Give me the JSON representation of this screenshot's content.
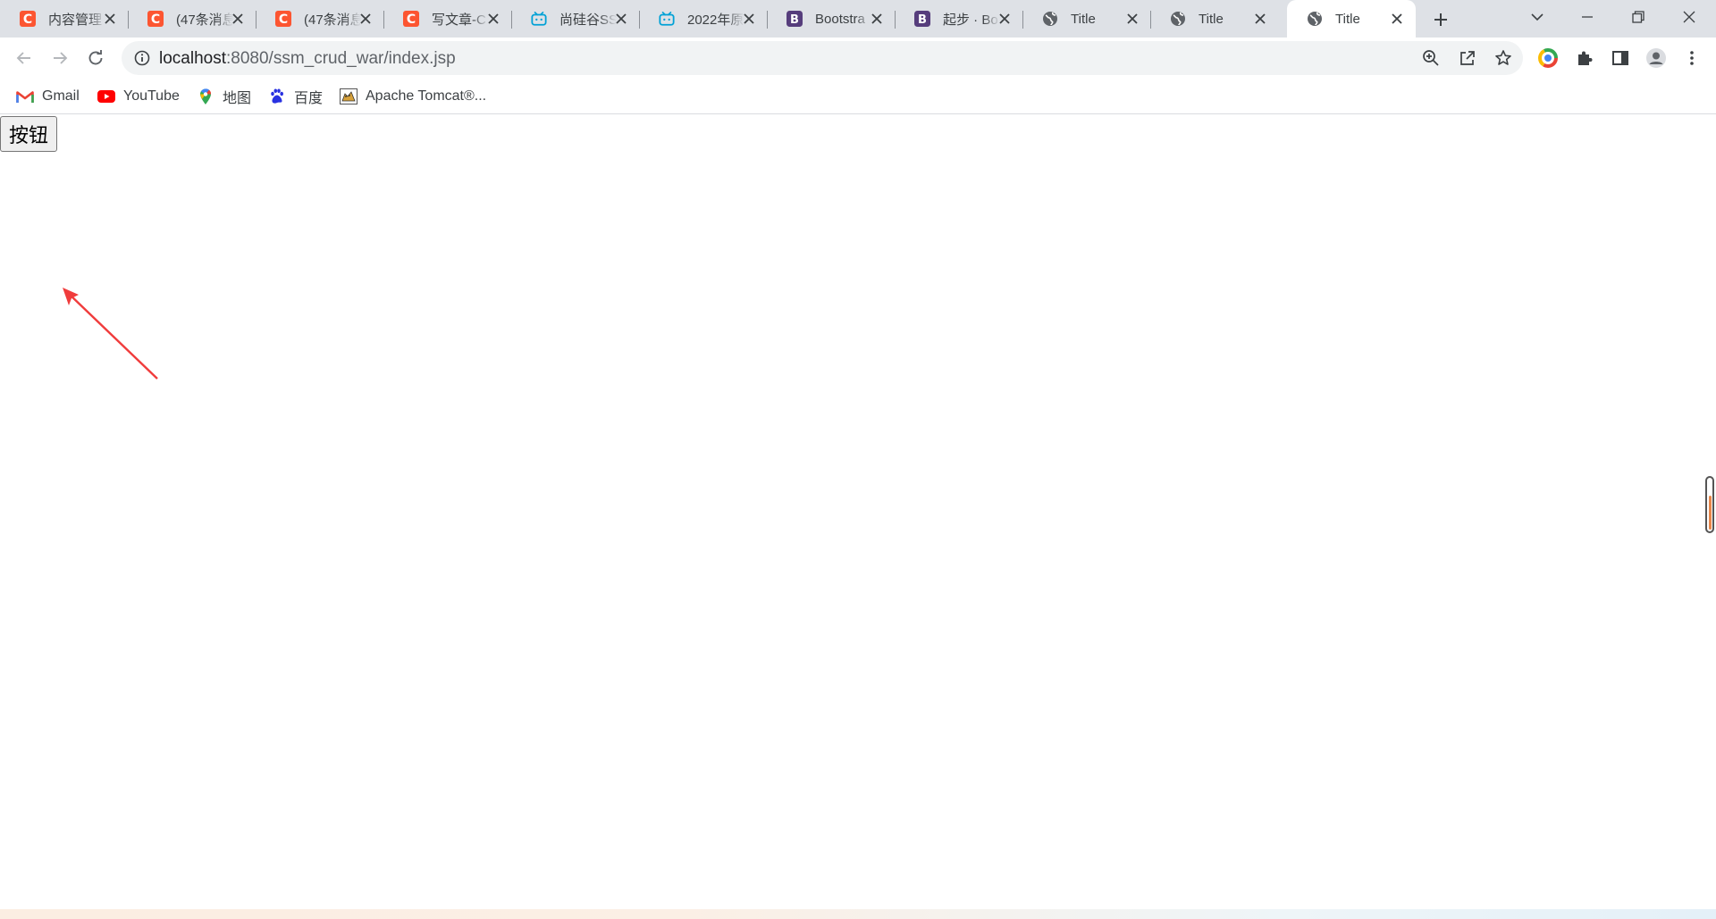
{
  "browser": {
    "tabs": [
      {
        "title": "内容管理",
        "favicon": "csdn-icon",
        "active": false
      },
      {
        "title": "(47条消息",
        "favicon": "csdn-icon",
        "active": false
      },
      {
        "title": "(47条消息",
        "favicon": "csdn-icon",
        "active": false
      },
      {
        "title": "写文章-C",
        "favicon": "csdn-icon",
        "active": false
      },
      {
        "title": "尚硅谷SS",
        "favicon": "bilibili-icon",
        "active": false
      },
      {
        "title": "2022年原",
        "favicon": "bilibili-icon",
        "active": false
      },
      {
        "title": "Bootstra",
        "favicon": "bootstrap-icon",
        "active": false
      },
      {
        "title": "起步 · Bo",
        "favicon": "bootstrap-icon",
        "active": false
      },
      {
        "title": "Title",
        "favicon": "globe-icon",
        "active": false
      },
      {
        "title": "Title",
        "favicon": "globe-icon",
        "active": false
      },
      {
        "title": "Title",
        "favicon": "globe-icon",
        "active": true
      }
    ],
    "url_host": "localhost",
    "url_rest": ":8080/ssm_crud_war/index.jsp",
    "bookmarks": [
      {
        "label": "Gmail",
        "icon": "gmail-icon"
      },
      {
        "label": "YouTube",
        "icon": "youtube-icon"
      },
      {
        "label": "地图",
        "icon": "maps-icon"
      },
      {
        "label": "百度",
        "icon": "baidu-icon"
      },
      {
        "label": "Apache Tomcat®...",
        "icon": "tomcat-icon"
      }
    ]
  },
  "page": {
    "button_label": "按钮"
  },
  "colors": {
    "csdn": "#fc5531",
    "bilibili": "#00a1d6",
    "bootstrap": "#563d7c",
    "arrow": "#f03c3c",
    "tabstrip": "#dee1e6"
  }
}
